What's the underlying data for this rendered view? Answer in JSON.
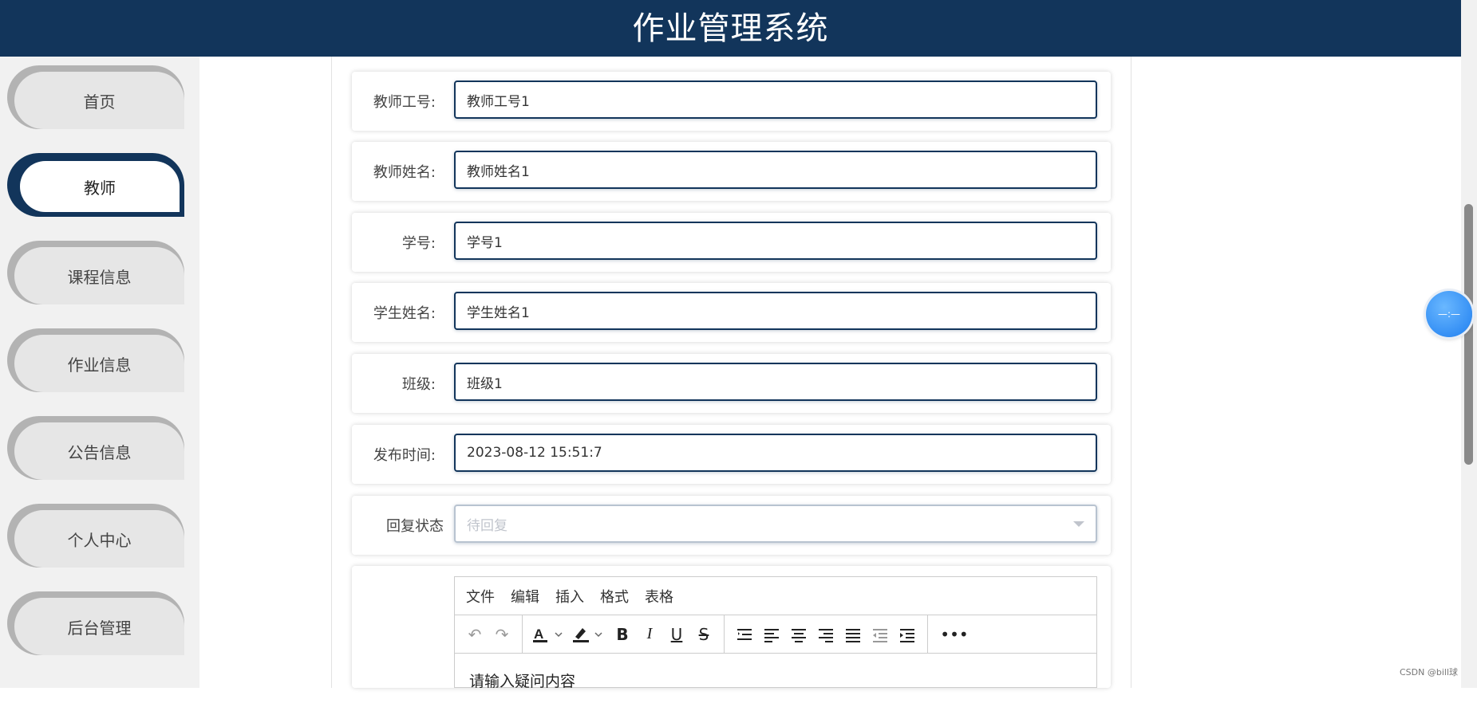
{
  "app": {
    "title": "作业管理系统"
  },
  "sidebar": {
    "items": [
      {
        "label": "首页",
        "active": false
      },
      {
        "label": "教师",
        "active": true
      },
      {
        "label": "课程信息",
        "active": false
      },
      {
        "label": "作业信息",
        "active": false
      },
      {
        "label": "公告信息",
        "active": false
      },
      {
        "label": "个人中心",
        "active": false
      },
      {
        "label": "后台管理",
        "active": false
      }
    ]
  },
  "form": {
    "fields": [
      {
        "label": "教师工号:",
        "value": "教师工号1"
      },
      {
        "label": "教师姓名:",
        "value": "教师姓名1"
      },
      {
        "label": "学号:",
        "value": "学号1"
      },
      {
        "label": "学生姓名:",
        "value": "学生姓名1"
      },
      {
        "label": "班级:",
        "value": "班级1"
      },
      {
        "label": "发布时间:",
        "value": "2023-08-12 15:51:7"
      }
    ],
    "reply_status": {
      "label": "回复状态",
      "placeholder": "待回复"
    }
  },
  "editor": {
    "menu": [
      "文件",
      "编辑",
      "插入",
      "格式",
      "表格"
    ],
    "toolbar_icons": [
      "undo-icon",
      "redo-icon",
      "font-color-icon",
      "highlight-icon",
      "bold-icon",
      "italic-icon",
      "underline-icon",
      "strikethrough-icon",
      "line-height-icon",
      "align-left-icon",
      "align-center-icon",
      "align-right-icon",
      "align-justify-icon",
      "outdent-icon",
      "indent-icon",
      "more-icon"
    ],
    "placeholder": "请输入疑问内容"
  },
  "float_ball": {
    "text": "—:—"
  },
  "watermark": {
    "text": "CSDN @bill球"
  },
  "colors": {
    "header": "#12355b",
    "accent": "#12355b"
  }
}
